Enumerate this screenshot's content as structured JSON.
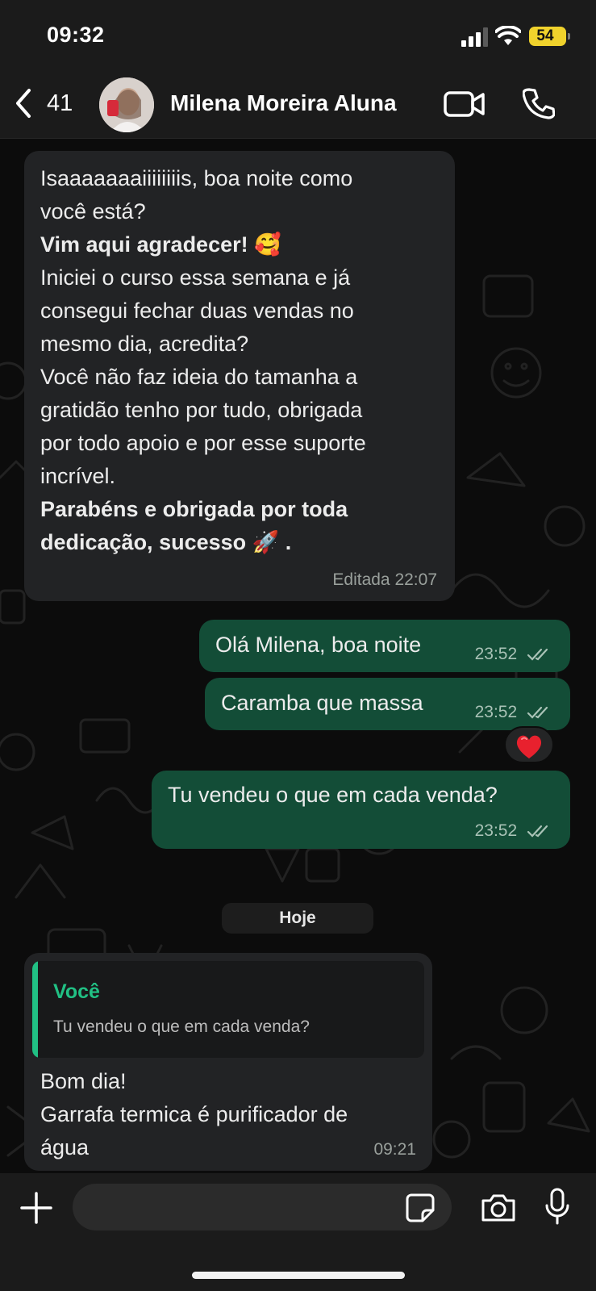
{
  "status_bar": {
    "time": "09:32",
    "battery": "54"
  },
  "header": {
    "back_count": "41",
    "contact_name": "Milena Moreira Aluna"
  },
  "messages": [
    {
      "direction": "incoming",
      "lines": [
        {
          "text": "Isaaaaaaaiiiiiiiis, boa noite como",
          "bold": false
        },
        {
          "text": "você está?",
          "bold": false
        },
        {
          "text": "Vim aqui agradecer! 🥰",
          "bold": true
        },
        {
          "text": "Iniciei o curso essa semana e já",
          "bold": false
        },
        {
          "text": "consegui fechar duas vendas no",
          "bold": false
        },
        {
          "text": "mesmo dia, acredita?",
          "bold": false
        },
        {
          "text": "Você não faz ideia do tamanha a",
          "bold": false
        },
        {
          "text": "gratidão tenho por tudo, obrigada",
          "bold": false
        },
        {
          "text": "por todo apoio e por esse suporte",
          "bold": false
        },
        {
          "text": "incrível.",
          "bold": false
        },
        {
          "text": "Parabéns e obrigada por toda",
          "bold": true
        },
        {
          "text": "dedicação, sucesso 🚀 .",
          "bold": true
        }
      ],
      "meta": "Editada 22:07"
    },
    {
      "direction": "outgoing",
      "text": "Olá Milena, boa noite",
      "time": "23:52"
    },
    {
      "direction": "outgoing",
      "text": "Caramba que massa",
      "time": "23:52",
      "reaction": "❤️"
    },
    {
      "direction": "outgoing",
      "text": "Tu vendeu o que em cada venda?",
      "time": "23:52"
    },
    {
      "direction": "incoming",
      "quote": {
        "author": "Você",
        "text": "Tu vendeu o que em cada venda?"
      },
      "lines": [
        "Bom dia!",
        "Garrafa termica é purificador de",
        "água"
      ],
      "time": "09:21"
    }
  ],
  "day_separator": "Hoje",
  "input_bar": {
    "placeholder": ""
  },
  "icons": [
    "back-chevron",
    "video-call",
    "phone-call",
    "plus",
    "sticker",
    "camera",
    "microphone"
  ],
  "colors": {
    "outgoing_bubble": "#134d37",
    "incoming_bubble": "#222325",
    "accent": "#21c084",
    "battery": "#f0d22c"
  }
}
